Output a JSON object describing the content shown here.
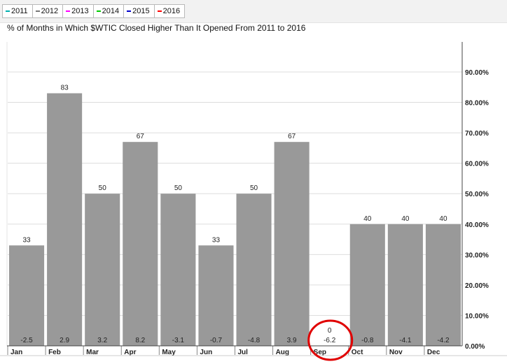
{
  "legend": {
    "items": [
      {
        "label": "2011",
        "color": "#00b0b0"
      },
      {
        "label": "2012",
        "color": "#777777"
      },
      {
        "label": "2013",
        "color": "#ff00ff"
      },
      {
        "label": "2014",
        "color": "#00cc00"
      },
      {
        "label": "2015",
        "color": "#0000cc"
      },
      {
        "label": "2016",
        "color": "#ff0000"
      }
    ]
  },
  "chart_data": {
    "type": "bar",
    "title": "% of Months in Which $WTIC Closed Higher Than It Opened From 2011 to 2016",
    "categories": [
      "Jan",
      "Feb",
      "Mar",
      "Apr",
      "May",
      "Jun",
      "Jul",
      "Aug",
      "Sep",
      "Oct",
      "Nov",
      "Dec"
    ],
    "values": [
      33,
      83,
      50,
      67,
      50,
      33,
      50,
      67,
      0,
      40,
      40,
      40
    ],
    "value_labels": [
      "33",
      "83",
      "50",
      "67",
      "50",
      "33",
      "50",
      "67",
      "0",
      "40",
      "40",
      "40"
    ],
    "avg_change_labels": [
      "-2.5",
      "2.9",
      "3.2",
      "8.2",
      "-3.1",
      "-0.7",
      "-4.8",
      "3.9",
      "-6.2",
      "-0.8",
      "-4.1",
      "-4.2"
    ],
    "ylim": [
      0,
      100
    ],
    "y_ticks": [
      "0.00%",
      "10.00%",
      "20.00%",
      "30.00%",
      "40.00%",
      "50.00%",
      "60.00%",
      "70.00%",
      "80.00%",
      "90.00%"
    ],
    "y_axis_side": "right",
    "grid": true,
    "bar_color": "#999999",
    "highlight": {
      "category": "Sep",
      "color": "#e00000"
    }
  }
}
